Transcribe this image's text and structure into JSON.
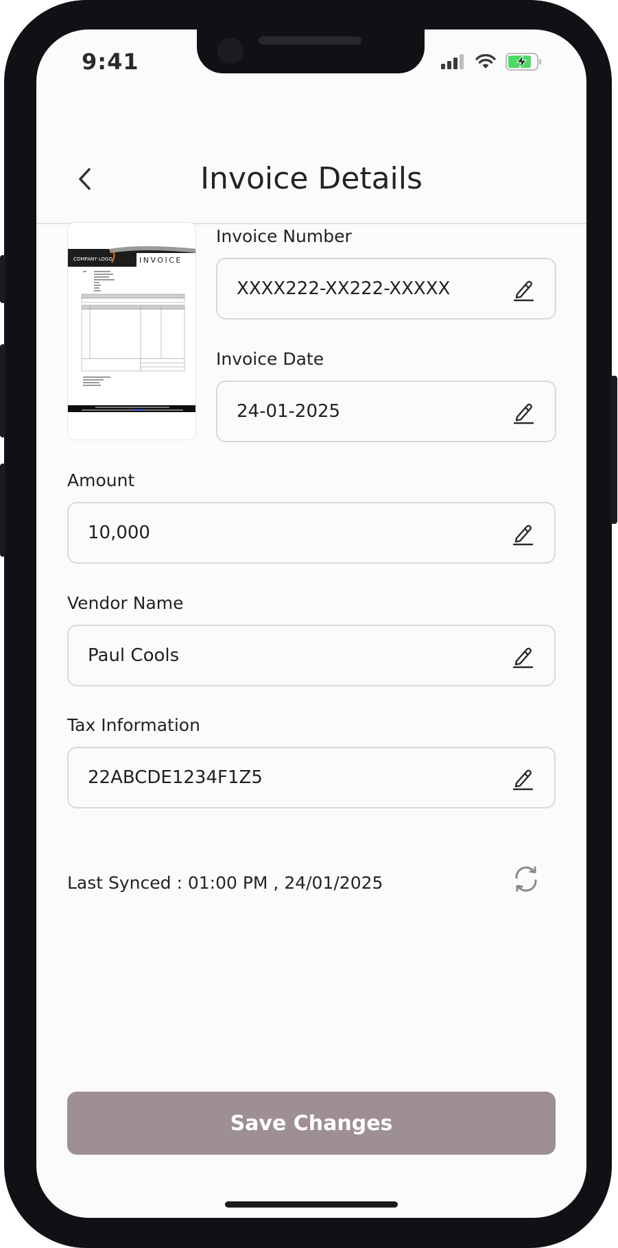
{
  "status_bar": {
    "time": "9:41"
  },
  "header": {
    "title": "Invoice Details"
  },
  "thumbnail": {
    "logo_text": "COMPANY LOGO",
    "doc_title": "INVOICE"
  },
  "fields": {
    "invoice_number": {
      "label": "Invoice Number",
      "value": "XXXX222-XX222-XXXXX"
    },
    "invoice_date": {
      "label": "Invoice Date",
      "value": "24-01-2025"
    },
    "amount": {
      "label": "Amount",
      "value": "10,000"
    },
    "vendor_name": {
      "label": "Vendor Name",
      "value": "Paul Cools"
    },
    "tax_information": {
      "label": "Tax Information",
      "value": "22ABCDE1234F1Z5"
    }
  },
  "sync": {
    "text": "Last Synced : 01:00 PM , 24/01/2025"
  },
  "actions": {
    "save_label": "Save Changes"
  },
  "colors": {
    "primary_button": "#9e8f94",
    "background": "#fcfbfb",
    "battery": "#4cd964"
  },
  "icons": [
    "chevron-left-icon",
    "pencil-icon",
    "sync-icon",
    "signal-icon",
    "wifi-icon",
    "battery-charging-icon"
  ]
}
